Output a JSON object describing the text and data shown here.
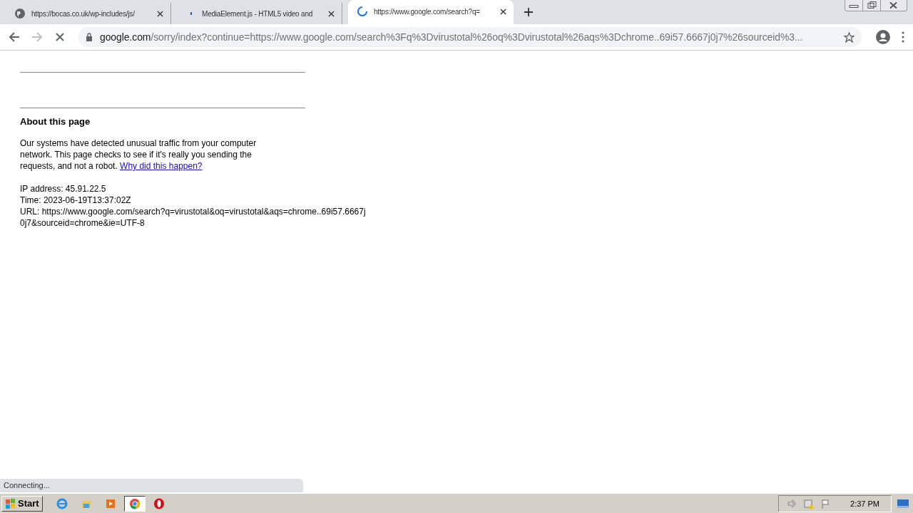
{
  "tabs": [
    {
      "title": "https://bocas.co.uk/wp-includes/js/",
      "kind": "globe",
      "selected": false
    },
    {
      "title": "MediaElement.js - HTML5 video and",
      "kind": "dot",
      "selected": false
    },
    {
      "title": "https://www.google.com/search?q=",
      "kind": "spinner",
      "selected": true
    }
  ],
  "address_bar": {
    "domain": "google.com",
    "path": "/sorry/index?continue=https://www.google.com/search%3Fq%3Dvirustotal%26oq%3Dvirustotal%26aqs%3Dchrome..69i57.6667j0j7%26sourceid%3..."
  },
  "page": {
    "heading": "About this page",
    "message": "Our systems have detected unusual traffic from your computer network. This page checks to see if it's really you sending the requests, and not a robot.",
    "link": "Why did this happen?",
    "details": [
      "IP address: 45.91.22.5",
      "Time: 2023-06-19T13:37:02Z",
      "URL: https://www.google.com/search?q=virustotal&oq=virustotal&aqs=chrome..69i57.6667j0j7&sourceid=chrome&ie=UTF-8"
    ]
  },
  "status_bar": "Connecting...",
  "taskbar": {
    "start": "Start",
    "apps": [
      {
        "kind": "ie",
        "selected": false
      },
      {
        "kind": "folder",
        "selected": false
      },
      {
        "kind": "media",
        "selected": false
      },
      {
        "kind": "chrome",
        "selected": true
      },
      {
        "kind": "opera",
        "selected": false
      }
    ],
    "clock": "2:37 PM"
  }
}
